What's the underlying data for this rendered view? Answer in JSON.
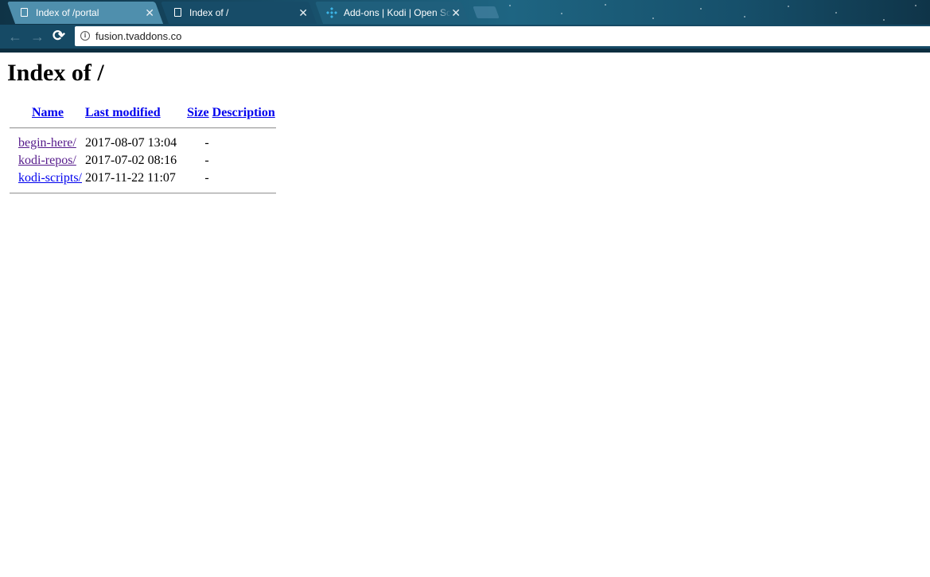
{
  "browser": {
    "tabs": [
      {
        "title": "Index of /portal",
        "close": "✕",
        "icon": "page-icon"
      },
      {
        "title": "Index of /",
        "close": "✕",
        "icon": "page-icon"
      },
      {
        "title": "Add-ons | Kodi | Open Sc",
        "close": "✕",
        "icon": "kodi-logo-icon"
      }
    ],
    "nav": {
      "back": "←",
      "forward": "→",
      "reload": "⟳"
    },
    "address": {
      "info_icon": "i",
      "url": "fusion.tvaddons.co"
    }
  },
  "page": {
    "title": "Index of /",
    "columns": {
      "name": "Name",
      "last_modified": "Last modified",
      "size": "Size",
      "description": "Description"
    },
    "rows": [
      {
        "name": "begin-here/",
        "modified": "2017-08-07 13:04",
        "size": "-",
        "description": ""
      },
      {
        "name": "kodi-repos/",
        "modified": "2017-07-02 08:16",
        "size": "-",
        "description": ""
      },
      {
        "name": "kodi-scripts/",
        "modified": "2017-11-22 11:07",
        "size": "-",
        "description": ""
      }
    ],
    "colors": {
      "link": "#0000ee",
      "visited_link": "#551a8b"
    }
  }
}
